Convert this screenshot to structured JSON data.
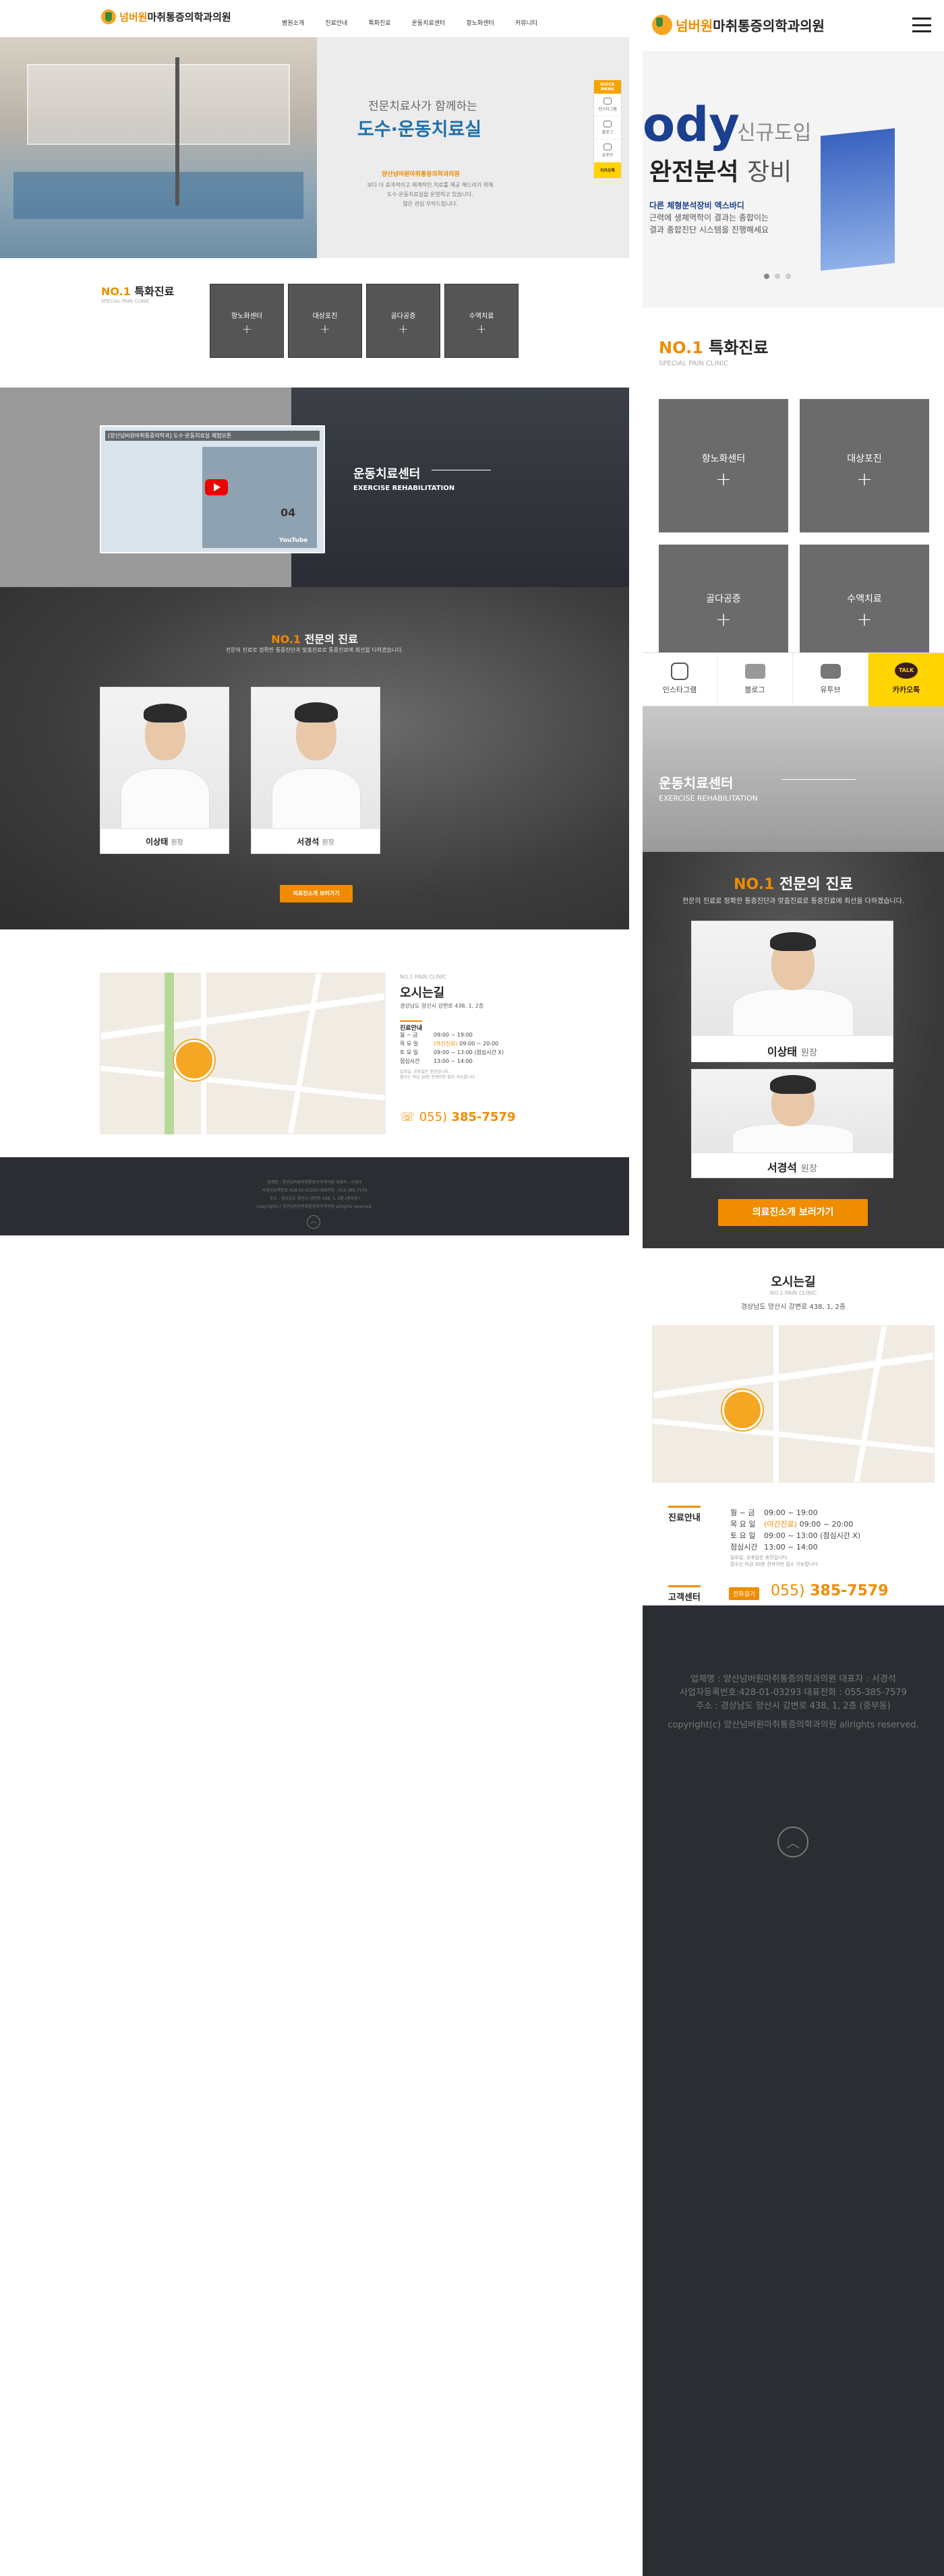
{
  "brand": {
    "name_orange": "넘버원",
    "name_dark": "마취통증의학과의원",
    "badge": "양산"
  },
  "nav": [
    "병원소개",
    "진료안내",
    "특화진료",
    "운동치료센터",
    "항노화센터",
    "커뮤니티"
  ],
  "hero": {
    "subtitle": "전문치료사가 함께하는",
    "title": "도수·운동치료실",
    "org": "양산넘버원마취통증의학과의원",
    "lines": [
      "보다 더 효과적이고 체계적인 치료를 제공 해드리기 위해",
      "도수·운동치료실을 운영하고 있습니다.",
      "많은 관심 부탁드립니다."
    ]
  },
  "quick_menu": {
    "header": "QUICK MENU",
    "items": [
      "인스타그램",
      "블로그",
      "유투브"
    ],
    "talk": "카카오톡"
  },
  "special": {
    "title_no1": "NO.1",
    "title": "특화진료",
    "sub": "SPECIAL PAIN CLINIC",
    "items": [
      "항노화센터",
      "대상포진",
      "골다공증",
      "수액치료"
    ]
  },
  "exercise": {
    "video_title": "[양산넘버원마취통증의학과] 도수·운동치료실 체험모존",
    "video_num": "04",
    "video_brand": "YouTube",
    "title": "운동치료센터",
    "sub": "EXERCISE REHABILITATION"
  },
  "doctors": {
    "title_no1": "NO.1",
    "title": "전문의 진료",
    "desc": "전문의 진료로 정확한 통증진단과 맞춤진료로 통증진료에 최선을 다하겠습니다.",
    "list": [
      {
        "name": "이상태",
        "role": "원장"
      },
      {
        "name": "서경석",
        "role": "원장"
      }
    ],
    "button": "의료진소개 보러가기"
  },
  "location": {
    "clinic": "NO.1 PAIN CLINIC",
    "title": "오시는길",
    "address": "경상남도 양산시 강변로 438, 1, 2층",
    "hours_title": "진료안내",
    "hours": [
      {
        "day": "월 ~ 금",
        "time": "09:00 ~ 19:00"
      },
      {
        "day": "목 요 일",
        "tag": "(야간진료)",
        "time": "09:00 ~ 20:00"
      },
      {
        "day": "토 요 일",
        "time": "09:00 ~ 13:00 (점심시간 X)"
      },
      {
        "day": "점심시간",
        "time": "13:00 ~ 14:00"
      }
    ],
    "note1": "일요일, 공휴일은 휴진입니다.",
    "note2": "접수는 마감 30분 전까지만 접수 가능합니다.",
    "call_title": "고객센터",
    "call_tag": "전화걸기",
    "phone_area": "055)",
    "phone": "385-7579"
  },
  "footer": {
    "company": "업체명 : 양산넘버원마취통증의학과의원  대표자 : 서경석",
    "biz": "사업자등록번호:428-01-03293  대표전화 : 055-385-7579",
    "addr": "주소 : 경상남도 양산시 강변로 438, 1, 2층 (중부동)",
    "copy": "copyright(c) 양산넘버원마취통증의학과의원 allrights reserved."
  },
  "mobile_banner": {
    "brand": "ody",
    "tag": "신규도입",
    "title": "완전분석",
    "title2": "장비",
    "line1": "다른 체형분석장비 엑스바디",
    "line2": "근력에 생체역학이 결과는 종합이는",
    "line3": "결과 종합진단 시스템을 진행해세요"
  },
  "colors": {
    "accent": "#f08c00",
    "dark": "#2a2e33",
    "talk": "#ffd400"
  }
}
